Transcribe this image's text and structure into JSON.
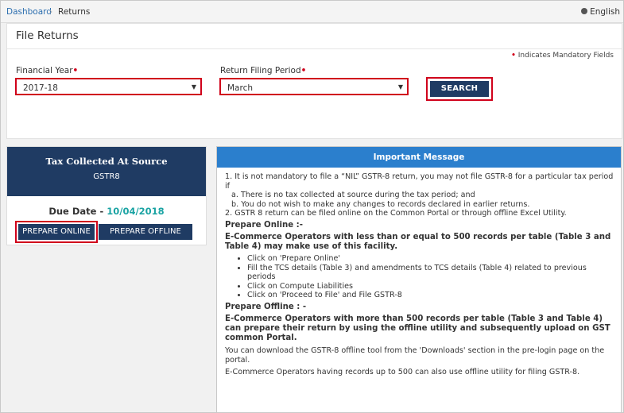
{
  "breadcrumb": {
    "link": "Dashboard",
    "separator": "›",
    "current": "Returns"
  },
  "language": "English",
  "panel": {
    "title": "File Returns",
    "mandatory_star": "•",
    "mandatory_note": "Indicates Mandatory Fields",
    "financial_year": {
      "label": "Financial Year",
      "star": "•",
      "value": "2017-18"
    },
    "period": {
      "label": "Return Filing Period",
      "star": "•",
      "value": "March"
    },
    "search_label": "SEARCH"
  },
  "card": {
    "title": "Tax Collected At Source",
    "subtitle": "GSTR8",
    "due_label": "Due Date -",
    "due_date": "10/04/2018",
    "prepare_online": "PREPARE ONLINE",
    "prepare_offline": "PREPARE OFFLINE"
  },
  "message": {
    "title": "Important Message",
    "p1": "1. It is not mandatory to file a “NIL” GSTR-8 return, you may not file GSTR-8 for a particular tax period if",
    "p1a": "a. There is no tax collected at source during the tax period; and",
    "p1b": "b. You do not wish to make any changes to records declared in earlier returns.",
    "p2": "2. GSTR 8 return can be filed online on the Common Portal or through offline Excel Utility.",
    "online_heading": "Prepare Online :-",
    "online_bold": "E-Commerce Operators with less than or equal to 500 records per table (Table 3 and Table 4) may make use of this facility.",
    "online_steps": [
      "Click on 'Prepare Online'",
      "Fill the TCS details (Table 3) and amendments to TCS details (Table 4) related to previous periods",
      "Click on Compute Liabilities",
      "Click on 'Proceed to File' and File GSTR-8"
    ],
    "offline_heading": "Prepare Offline : -",
    "offline_bold": "E-Commerce Operators with more than 500 records per table (Table 3 and Table 4) can prepare their return by using the offline utility and subsequently upload on GST common Portal.",
    "offline_p1": "You can download the GSTR-8 offline tool from the 'Downloads' section in the pre-login page on the portal.",
    "offline_p2": "E-Commerce Operators having records up to 500 can also use offline utility for filing GSTR-8."
  }
}
